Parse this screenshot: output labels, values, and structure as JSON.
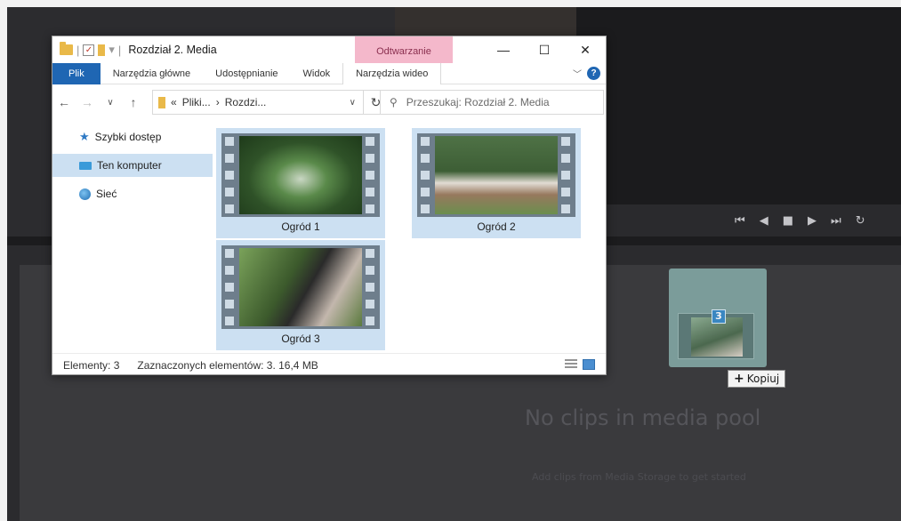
{
  "explorer": {
    "title": "Rozdział 2. Media",
    "context_tab_header": "Odtwarzanie",
    "controls": {
      "minimize": "—",
      "maximize": "☐",
      "close": "✕"
    },
    "ribbon_tabs": [
      {
        "label": "Plik"
      },
      {
        "label": "Narzędzia główne"
      },
      {
        "label": "Udostępnianie"
      },
      {
        "label": "Widok"
      },
      {
        "label": "Narzędzia wideo"
      }
    ],
    "address": {
      "prefix": "«",
      "segments": [
        "Pliki...",
        "Rozdzi..."
      ],
      "separator": "›"
    },
    "search_placeholder": "Przeszukaj: Rozdział 2. Media",
    "sidebar": [
      {
        "label": "Szybki dostęp",
        "icon": "star-icon"
      },
      {
        "label": "Ten komputer",
        "icon": "computer-icon",
        "selected": true
      },
      {
        "label": "Sieć",
        "icon": "network-icon"
      }
    ],
    "files": [
      {
        "name": "Ogród 1",
        "selected": true
      },
      {
        "name": "Ogród 2",
        "selected": true
      },
      {
        "name": "Ogród 3",
        "selected": true
      }
    ],
    "status": {
      "items": "Elementy: 3",
      "selected": "Zaznaczonych elementów: 3. 16,4 MB"
    }
  },
  "drag": {
    "count": "3",
    "tooltip": "Kopiuj"
  },
  "media_pool": {
    "empty_title": "No clips in media pool",
    "empty_subtitle": "Add clips from Media Storage to get started"
  },
  "colors": {
    "file_tab": "#1f66b3",
    "selection": "#cce0f2",
    "context_tab": "#f4b8cb",
    "app_background": "#3a3a3d"
  }
}
